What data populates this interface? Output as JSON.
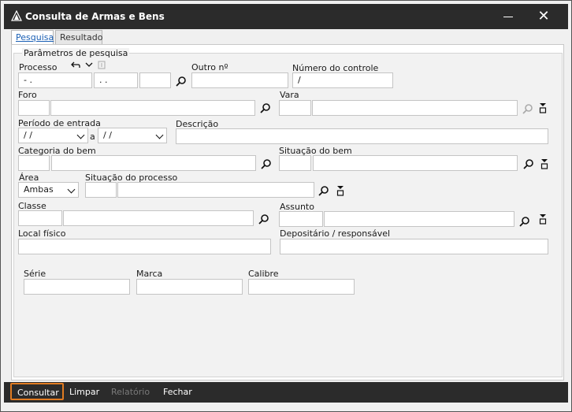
{
  "window": {
    "title": "Consulta de Armas e Bens"
  },
  "tabs": [
    {
      "label": "Pesquisa"
    },
    {
      "label": "Resultado"
    }
  ],
  "group": {
    "legend": "Parâmetros de pesquisa"
  },
  "processo": {
    "label": "Processo",
    "part1": "  -  .",
    "part2": " .  .",
    "part3": ""
  },
  "outro_n": {
    "label": "Outro nº",
    "value": ""
  },
  "numero_controle": {
    "label": "Número do controle",
    "value": "      /"
  },
  "foro": {
    "label": "Foro",
    "code": "",
    "name": ""
  },
  "vara": {
    "label": "Vara",
    "code": "",
    "name": ""
  },
  "periodo": {
    "label": "Período de entrada",
    "from": " / /",
    "sep": "a",
    "to": " / /"
  },
  "descricao": {
    "label": "Descrição",
    "value": ""
  },
  "categoria": {
    "label": "Categoria do bem",
    "code": "",
    "name": ""
  },
  "situacao_bem": {
    "label": "Situação do bem",
    "code": "",
    "name": ""
  },
  "area": {
    "label": "Área",
    "value": "Ambas"
  },
  "situacao_processo": {
    "label": "Situação do processo",
    "code": "",
    "name": ""
  },
  "classe": {
    "label": "Classe",
    "code": "",
    "name": ""
  },
  "assunto": {
    "label": "Assunto",
    "code": "",
    "name": ""
  },
  "local_fisico": {
    "label": "Local físico",
    "value": ""
  },
  "depositario": {
    "label": "Depositário / responsável",
    "value": ""
  },
  "serie": {
    "label": "Série",
    "value": ""
  },
  "marca": {
    "label": "Marca",
    "value": ""
  },
  "calibre": {
    "label": "Calibre",
    "value": ""
  },
  "footer": {
    "consultar": "Consultar",
    "limpar": "Limpar",
    "relatorio": "Relatório",
    "fechar": "Fechar"
  },
  "colors": {
    "titlebar": "#2b2b2b",
    "accent": "#e07b22",
    "link": "#1a5fb4"
  },
  "icons": [
    "app-logo-icon",
    "minimize-icon",
    "close-icon",
    "undo-icon",
    "chevron-down-icon",
    "info-icon",
    "search-icon",
    "eraser-icon"
  ]
}
